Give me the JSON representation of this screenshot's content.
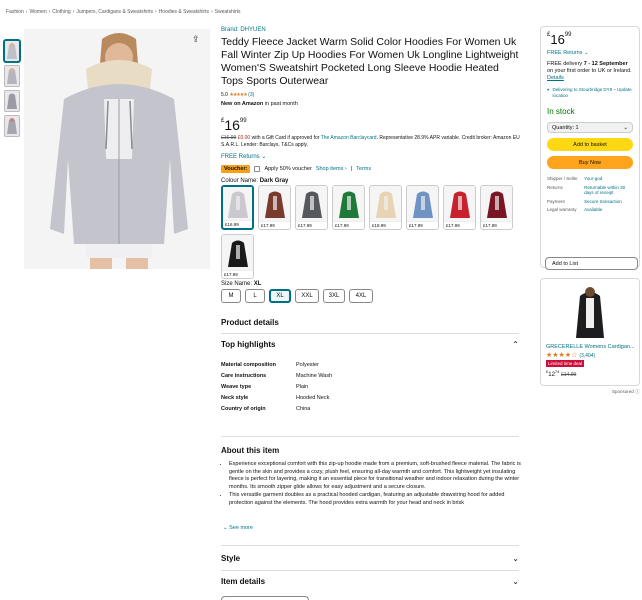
{
  "breadcrumb": [
    "Fashion",
    "›",
    "Women",
    "›",
    "Clothing",
    "›",
    "Jumpers, Cardigans & Sweatshirts",
    "›",
    "Hoodies & Sweatshirts",
    "›",
    "Sweatshirts"
  ],
  "product": {
    "brand": "Brand: DHYUEN",
    "title": "Teddy Fleece Jacket Warm Solid Color Hoodies For Women Uk Fall Winter Zip Up Hoodies For Women Uk Longline Lightweight Women'S Sweatshirt Pocketed Long Sleeve Hoodie Heated Tops Sports Outerwear",
    "rating_value": "5.0",
    "rating_stars": "★★★★★",
    "rating_count": "(3)",
    "bought_label": "New on Amazon",
    "bought_suffix": " in past month",
    "price_currency": "£",
    "price_whole": "16",
    "price_fraction": "99",
    "gift_strike": "£16.99",
    "gift_zero": "£0.00",
    "gift_text1": " with a Gift Card if approved for ",
    "gift_link": "The Amazon Barclaycard",
    "gift_text2": ". Representative 28.9% APR variable. Credit broker: Amazon EU S.A.R.L. Lender: Barclays. T&Cs apply.",
    "free_returns": "FREE Returns",
    "voucher_badge": "Voucher:",
    "voucher_text": "Apply 50% voucher",
    "voucher_shop": "Shop items ›",
    "voucher_sep": "|",
    "voucher_terms": "Terms",
    "colour_label": "Colour Name: ",
    "colour_value": "Dark Gray",
    "swatches": [
      {
        "price": "£16.99",
        "color": "#c9c9cf",
        "selected": true
      },
      {
        "price": "£17.99",
        "color": "#7a3b2e",
        "selected": false
      },
      {
        "price": "£17.99",
        "color": "#55585c",
        "selected": false
      },
      {
        "price": "£17.99",
        "color": "#1f7a3a",
        "selected": false
      },
      {
        "price": "£18.99",
        "color": "#e8d3b4",
        "selected": false
      },
      {
        "price": "£17.99",
        "color": "#6f93c4",
        "selected": false
      },
      {
        "price": "£17.99",
        "color": "#c8202c",
        "selected": false
      },
      {
        "price": "£17.99",
        "color": "#7a1524",
        "selected": false
      },
      {
        "price": "£17.99",
        "color": "#1a1a1a",
        "selected": false
      }
    ],
    "size_label": "Size Name: ",
    "size_value": "XL",
    "sizes": [
      "M",
      "L",
      "XL",
      "XXL",
      "3XL",
      "4XL"
    ]
  },
  "details": {
    "heading": "Product details",
    "top_highlights": "Top highlights",
    "specs": [
      {
        "k": "Material composition",
        "v": "Polyester"
      },
      {
        "k": "Care instructions",
        "v": "Machine Wash"
      },
      {
        "k": "Weave type",
        "v": "Plain"
      },
      {
        "k": "Neck style",
        "v": "Hooded Neck"
      },
      {
        "k": "Country of origin",
        "v": "China"
      }
    ],
    "about_heading": "About this item",
    "bullets": [
      "Experience exceptional comfort with this zip-up hoodie made from a premium, soft-brushed fleece material. The fabric is gentle on the skin and provides a cozy, plush feel, ensuring all-day warmth and comfort. This lightweight yet insulating fleece is perfect for layering, making it an essential piece for transitional weather and indoor relaxation during the winter months. Its smooth zipper glide allows for easy adjustment and a secure closure.",
      "This versatile garment doubles as a practical hooded cardigan, featuring an adjustable drawstring hood for added protection against the elements. The hood provides extra warmth for your head and neck in brisk"
    ],
    "see_more": "See more",
    "style": "Style",
    "item_details": "Item details"
  },
  "buybox": {
    "price_currency": "£",
    "price_whole": "16",
    "price_fraction": "99",
    "free_returns": "FREE Returns",
    "delivery_prefix": "FREE delivery ",
    "delivery_date": "7 - 12 September",
    "delivery_suffix": " on your first order to UK or Ireland. ",
    "details_link": "Details",
    "location": "Delivering to Stourbridge DY8 – Update location",
    "stock": "In stock",
    "quantity": "Quantity: 1",
    "add_to_basket": "Add to basket",
    "buy_now": "Buy Now",
    "info": [
      {
        "k": "Shipper / Seller",
        "v": "Your-god"
      },
      {
        "k": "Returns",
        "v": "Returnable within 30 days of receipt"
      },
      {
        "k": "Payment",
        "v": "Secure transaction"
      },
      {
        "k": "Legal warranty",
        "v": "Available"
      }
    ],
    "add_to_list": "Add to List"
  },
  "ad": {
    "title": "GRECERELLE Womens Cardigan...",
    "stars": "★★★★☆",
    "count": "(3,404)",
    "badge": "Limited time deal",
    "price_currency": "£",
    "price_whole": "12",
    "price_fraction": "74",
    "old_price": "£14.99",
    "sponsored": "Sponsored ⓘ"
  },
  "colors": {
    "link": "#007185",
    "add_button": "#ffd814",
    "buy_button": "#ffa41c",
    "in_stock": "#007600",
    "star": "#de7921",
    "deal": "#cc0c39"
  }
}
